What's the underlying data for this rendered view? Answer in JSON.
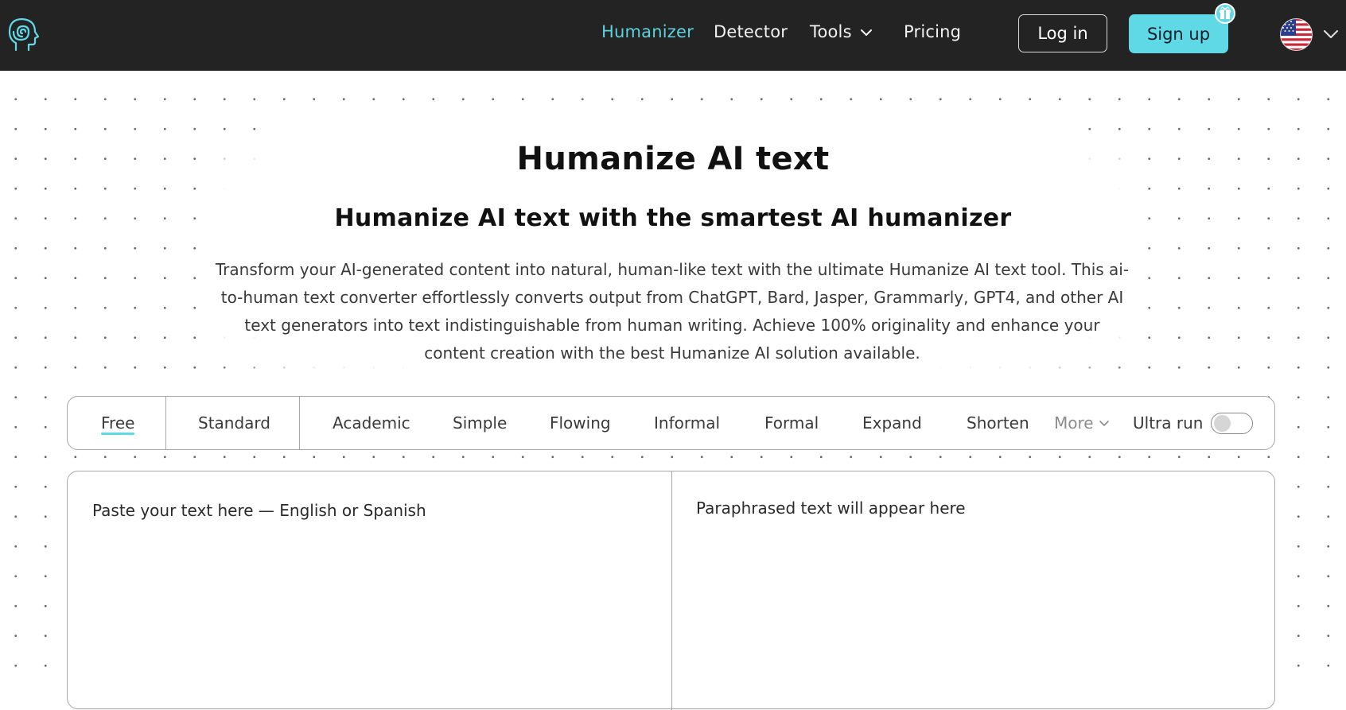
{
  "header": {
    "nav": [
      {
        "label": "Humanizer",
        "active": true
      },
      {
        "label": "Detector",
        "active": false
      },
      {
        "label": "Tools",
        "active": false,
        "has_dropdown": true
      },
      {
        "label": "Pricing",
        "active": false
      }
    ],
    "login_label": "Log in",
    "signup_label": "Sign up",
    "language_flag": "us-flag-icon",
    "colors": {
      "bar_background": "#232323",
      "accent": "#5fd9e6",
      "active_link": "#5cd2de"
    }
  },
  "hero": {
    "title": "Humanize AI text",
    "subtitle": "Humanize AI text with the smartest AI humanizer",
    "description": "Transform your AI-generated content into natural, human-like text with the ultimate Humanize AI text tool. This ai-to-human text converter effortlessly converts output from ChatGPT, Bard, Jasper, Grammarly, GPT4, and other AI text generators into text indistinguishable from human writing. Achieve 100% originality and enhance your content creation with the best Humanize AI solution available."
  },
  "modes": {
    "items": [
      {
        "label": "Free",
        "selected": true
      },
      {
        "label": "Standard"
      },
      {
        "label": "Academic"
      },
      {
        "label": "Simple"
      },
      {
        "label": "Flowing"
      },
      {
        "label": "Informal"
      },
      {
        "label": "Formal"
      },
      {
        "label": "Expand"
      },
      {
        "label": "Shorten"
      }
    ],
    "more_label": "More",
    "ultra_label": "Ultra run",
    "ultra_enabled": false
  },
  "editor": {
    "input_placeholder": "Paste your text here — English or Spanish",
    "input_value": "",
    "output_placeholder": "Paraphrased text will appear here"
  }
}
